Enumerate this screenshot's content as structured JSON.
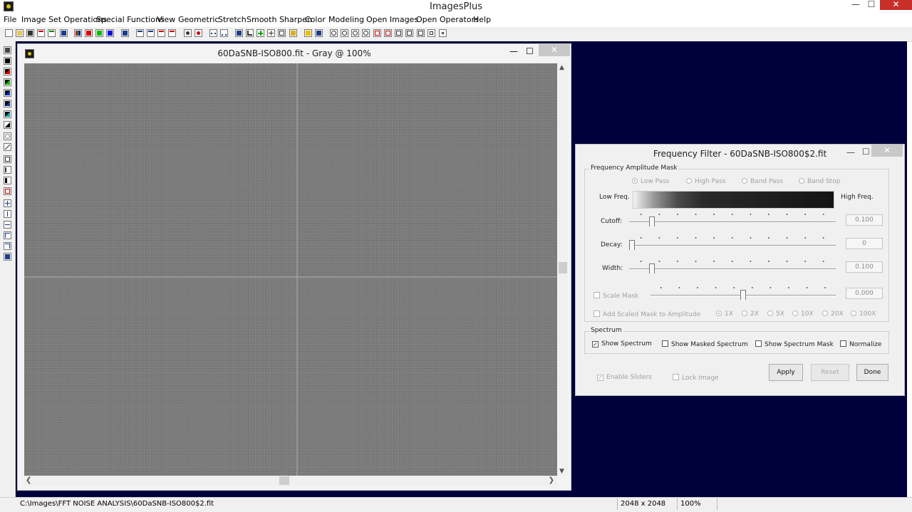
{
  "app": {
    "title": "ImagesPlus",
    "min": "—",
    "max": "☐",
    "close": "✕"
  },
  "menu": [
    "File",
    "Image Set Operations",
    "Special Functions",
    "View",
    "Geometric",
    "Stretch",
    "Smooth Sharpen",
    "Color",
    "Modeling",
    "Open Images",
    "Open Operators",
    "Help"
  ],
  "image_window": {
    "title": "60DaSNB-ISO800.fit - Gray @ 100%",
    "min": "—",
    "max": "☐",
    "close": "✕",
    "scroll_up": "▲",
    "scroll_down": "▼",
    "scroll_left": "❮",
    "scroll_right": "❯"
  },
  "dialog": {
    "title": "Frequency Filter - 60DaSNB-ISO800$2.fit",
    "min": "—",
    "max": "☐",
    "close": "✕",
    "amplitude_mask": {
      "legend": "Frequency Amplitude Mask",
      "filter_types": [
        {
          "label": "Low Pass",
          "selected": true
        },
        {
          "label": "High Pass",
          "selected": false
        },
        {
          "label": "Band Pass",
          "selected": false
        },
        {
          "label": "Band Stop",
          "selected": false
        }
      ],
      "low_freq_label": "Low Freq.",
      "high_freq_label": "High Freq.",
      "cutoff": {
        "label": "Cutoff:",
        "value": "0.100",
        "level": 0.1
      },
      "decay": {
        "label": "Decay:",
        "value": "0",
        "level": 0.0
      },
      "width": {
        "label": "Width:",
        "value": "0.100",
        "level": 0.1
      },
      "scale_mask": {
        "label": "Scale Mask",
        "checked": false,
        "value": "0.000",
        "level": 0.5
      },
      "add_scaled": {
        "label": "Add Scaled Mask to Amplitude",
        "checked": false
      },
      "multipliers": [
        {
          "label": "1X",
          "selected": true
        },
        {
          "label": "2X",
          "selected": false
        },
        {
          "label": "5X",
          "selected": false
        },
        {
          "label": "10X",
          "selected": false
        },
        {
          "label": "20X",
          "selected": false
        },
        {
          "label": "100X",
          "selected": false
        }
      ]
    },
    "spectrum": {
      "legend": "Spectrum",
      "options": [
        {
          "label": "Show Spectrum",
          "checked": true
        },
        {
          "label": "Show Masked Spectrum",
          "checked": false
        },
        {
          "label": "Show Spectrum Mask",
          "checked": false
        },
        {
          "label": "Normalize",
          "checked": false
        }
      ]
    },
    "enable_sliders": {
      "label": "Enable Sliders",
      "checked": true
    },
    "lock_image": {
      "label": "Lock Image",
      "checked": false
    },
    "buttons": {
      "apply": "Apply",
      "reset": "Reset",
      "done": "Done"
    }
  },
  "status": {
    "path": "C:\\Images\\FFT NOISE ANALYSIS\\60DaSNB-ISO800$2.fit",
    "dimensions": "2048 x 2048",
    "zoom": "100%"
  },
  "colors": {
    "mdi_background": "#00003c",
    "close_button": "#c7302a"
  }
}
